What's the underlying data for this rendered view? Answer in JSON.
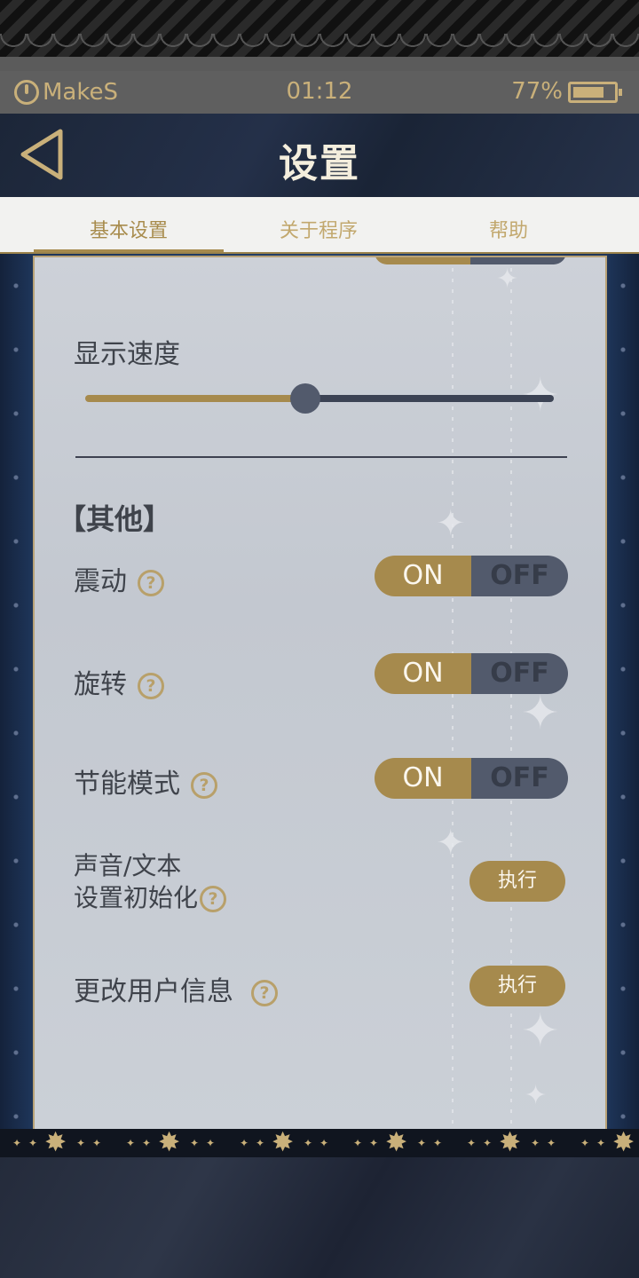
{
  "status_bar": {
    "brand": "MakeS",
    "time": "01:12",
    "battery_percent": "77%",
    "battery_level": 0.77,
    "icons": [
      "power-icon",
      "battery-icon"
    ]
  },
  "header": {
    "title": "设置",
    "back_icon": "back-triangle-icon"
  },
  "tabs": [
    {
      "label": "基本设置",
      "active": true
    },
    {
      "label": "关于程序",
      "active": false
    },
    {
      "label": "帮助",
      "active": false
    }
  ],
  "settings": {
    "display_speed": {
      "label": "显示速度",
      "level": 0.47
    },
    "other_section_title": "【其他】",
    "vibration": {
      "label": "震动",
      "on": "ON",
      "off": "OFF",
      "state": "ON"
    },
    "rotation": {
      "label": "旋转",
      "on": "ON",
      "off": "OFF",
      "state": "ON"
    },
    "power_saving": {
      "label": "节能模式",
      "on": "ON",
      "off": "OFF",
      "state": "ON"
    },
    "reset_sound_text": {
      "label_line1": "声音/文本",
      "label_line2": "设置初始化",
      "button": "执行"
    },
    "change_user_info": {
      "label": "更改用户信息",
      "button": "执行"
    },
    "help_icon_glyph": "?"
  },
  "colors": {
    "accent_gold": "#a68a4d",
    "toggle_off": "#525a6c",
    "panel_bg": "#c8ccd3",
    "header_bg": "#1e2840"
  }
}
